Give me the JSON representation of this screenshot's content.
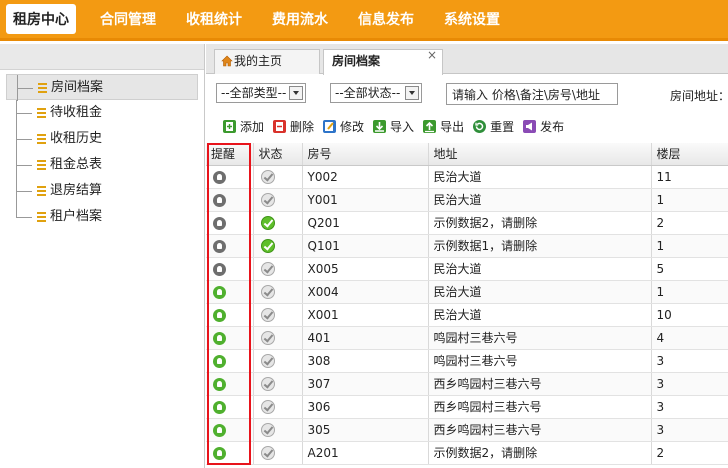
{
  "nav": [
    "租房中心",
    "合同管理",
    "收租统计",
    "费用流水",
    "信息发布",
    "系统设置"
  ],
  "sidebar": [
    "房间档案",
    "待收租金",
    "收租历史",
    "租金总表",
    "退房结算",
    "租户档案"
  ],
  "tabs": {
    "home": "我的主页",
    "active": "房间档案",
    "close": "×"
  },
  "filters": {
    "type": "--全部类型--",
    "status": "--全部状态--",
    "search_value": "请输入 价格\\备注\\房号\\地址",
    "address_label": "房间地址："
  },
  "toolbar": {
    "add": "添加",
    "delete": "删除",
    "edit": "修改",
    "import": "导入",
    "export": "导出",
    "reset": "重置",
    "publish": "发布"
  },
  "table": {
    "headers": [
      "提醒",
      "状态",
      "房号",
      "地址",
      "楼层"
    ],
    "rows": [
      {
        "remind": "grey",
        "status": "grey",
        "room": "Y002",
        "address": "民治大道",
        "floor": "11"
      },
      {
        "remind": "grey",
        "status": "grey",
        "room": "Y001",
        "address": "民治大道",
        "floor": "1"
      },
      {
        "remind": "grey",
        "status": "green",
        "room": "Q201",
        "address": "示例数据2，请删除",
        "floor": "2"
      },
      {
        "remind": "grey",
        "status": "green",
        "room": "Q101",
        "address": "示例数据1，请删除",
        "floor": "1"
      },
      {
        "remind": "grey",
        "status": "grey",
        "room": "X005",
        "address": "民治大道",
        "floor": "5"
      },
      {
        "remind": "green",
        "status": "grey",
        "room": "X004",
        "address": "民治大道",
        "floor": "1"
      },
      {
        "remind": "green",
        "status": "grey",
        "room": "X001",
        "address": "民治大道",
        "floor": "10"
      },
      {
        "remind": "green",
        "status": "grey",
        "room": "401",
        "address": "鸣园村三巷六号",
        "floor": "4"
      },
      {
        "remind": "green",
        "status": "grey",
        "room": "308",
        "address": "鸣园村三巷六号",
        "floor": "3"
      },
      {
        "remind": "green",
        "status": "grey",
        "room": "307",
        "address": "西乡鸣园村三巷六号",
        "floor": "3"
      },
      {
        "remind": "green",
        "status": "grey",
        "room": "306",
        "address": "西乡鸣园村三巷六号",
        "floor": "3"
      },
      {
        "remind": "green",
        "status": "grey",
        "room": "305",
        "address": "西乡鸣园村三巷六号",
        "floor": "3"
      },
      {
        "remind": "green",
        "status": "grey",
        "room": "A201",
        "address": "示例数据2，请删除",
        "floor": "2"
      }
    ]
  },
  "colors": {
    "accent": "#f39a12",
    "highlight": "#e8131b"
  }
}
